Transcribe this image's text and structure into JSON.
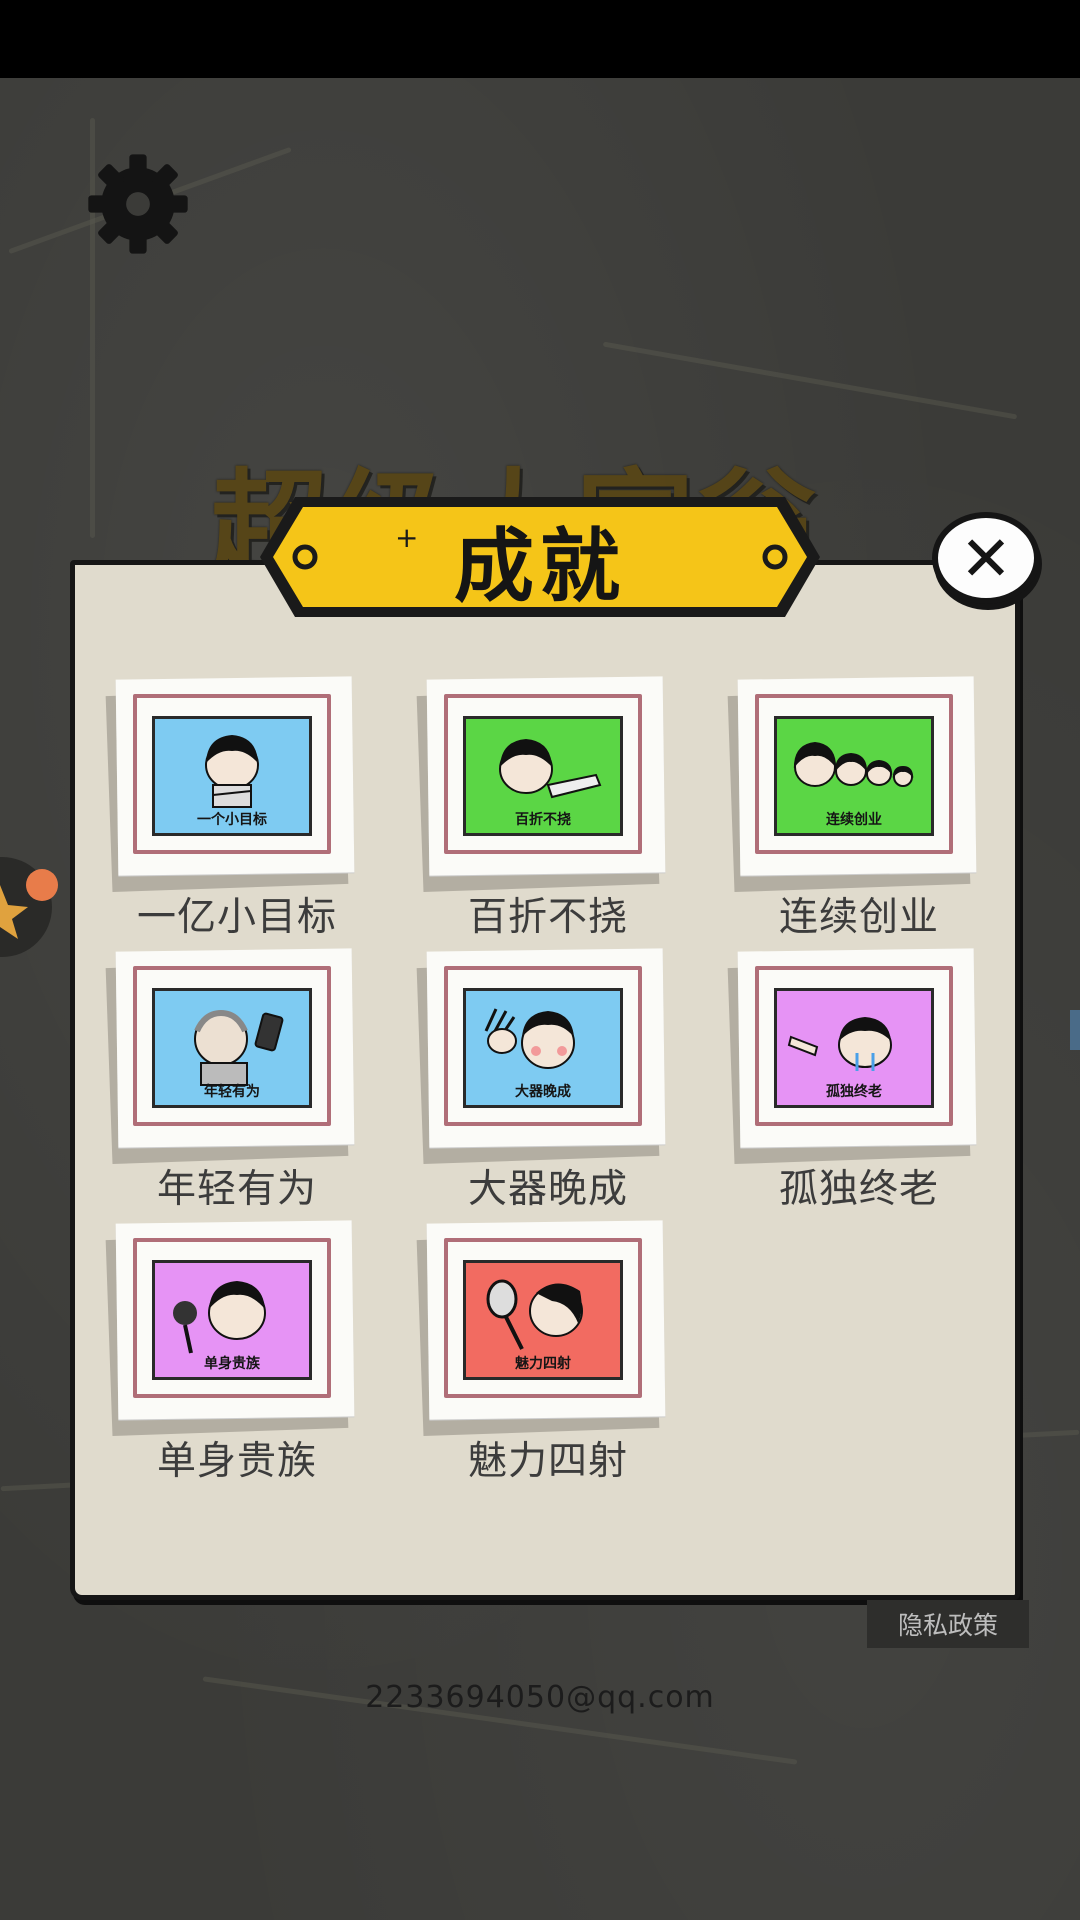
{
  "game": {
    "title": "超级大富翁"
  },
  "dialog": {
    "title": "成就",
    "close_label": "✕"
  },
  "achievements": [
    {
      "label": "一亿小目标",
      "caption": "一个小目标",
      "color": "#7ecbf2",
      "icon": "boy-folded-arms"
    },
    {
      "label": "百折不挠",
      "caption": "百折不挠",
      "color": "#5bd645",
      "icon": "boy-lying-down"
    },
    {
      "label": "连续创业",
      "caption": "连续创业",
      "color": "#5bd645",
      "icon": "row-of-boys"
    },
    {
      "label": "年轻有为",
      "caption": "年轻有为",
      "color": "#7ecbf2",
      "icon": "old-man-phone"
    },
    {
      "label": "大器晚成",
      "caption": "大器晚成",
      "color": "#7ecbf2",
      "icon": "boy-waving"
    },
    {
      "label": "孤独终老",
      "caption": "孤独终老",
      "color": "#e693f5",
      "icon": "boy-crying"
    },
    {
      "label": "单身贵族",
      "caption": "单身贵族",
      "color": "#e693f5",
      "icon": "boy-with-fan"
    },
    {
      "label": "魅力四射",
      "caption": "魅力四射",
      "color": "#f26b61",
      "icon": "boy-with-mirror"
    }
  ],
  "footer": {
    "privacy_label": "隐私政策",
    "email": "2233694050@qq.com"
  }
}
